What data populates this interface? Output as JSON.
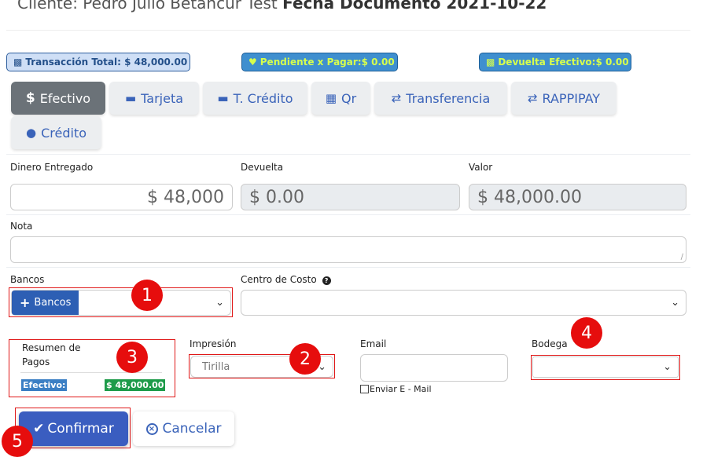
{
  "header": {
    "cliente_prefix": "Cliente: Pedro Julio Betancur Test",
    "fecha_label": "Fecha Documento 2021-10-22"
  },
  "badges": {
    "total": "Transacción Total: $ 48,000.00",
    "pendiente": "Pendiente x Pagar:$ 0.00",
    "devuelta": "Devuelta Efectivo:$ 0.00"
  },
  "tabs": [
    {
      "label": "Efectivo",
      "icon": "$"
    },
    {
      "label": "Tarjeta",
      "icon": "card-icon"
    },
    {
      "label": "T. Crédito",
      "icon": "card-icon"
    },
    {
      "label": "Qr",
      "icon": "qr-icon"
    },
    {
      "label": "Transferencia",
      "icon": "transfer-icon"
    },
    {
      "label": "RAPPIPAY",
      "icon": "transfer-icon"
    },
    {
      "label": "Crédito",
      "icon": "piggy-bank-icon"
    }
  ],
  "fields": {
    "dinero_label": "Dinero Entregado",
    "dinero_value": "$ 48,000",
    "devuelta_label": "Devuelta",
    "devuelta_value": "$ 0.00",
    "valor_label": "Valor",
    "valor_value": "$ 48,000.00",
    "nota_label": "Nota",
    "bancos_label": "Bancos",
    "bancos_button": "Bancos",
    "centro_label": "Centro de Costo",
    "impresion_label": "Impresión",
    "impresion_value": "Tirilla",
    "email_label": "Email",
    "enviar_label": "Enviar E - Mail",
    "bodega_label": "Bodega"
  },
  "resumen": {
    "title_line1": "Resumen de",
    "title_line2": "Pagos",
    "item_label": "Efectivo:",
    "item_value": "$ 48,000.00"
  },
  "actions": {
    "confirm": "Confirmar",
    "cancel": "Cancelar"
  },
  "markers": [
    "1",
    "2",
    "3",
    "4",
    "5"
  ],
  "colors": {
    "accent": "#3a5dc0",
    "marker": "#e60d0d",
    "resumen_label_bg": "#3b7fc4",
    "resumen_value_bg": "#1e9b4a"
  }
}
